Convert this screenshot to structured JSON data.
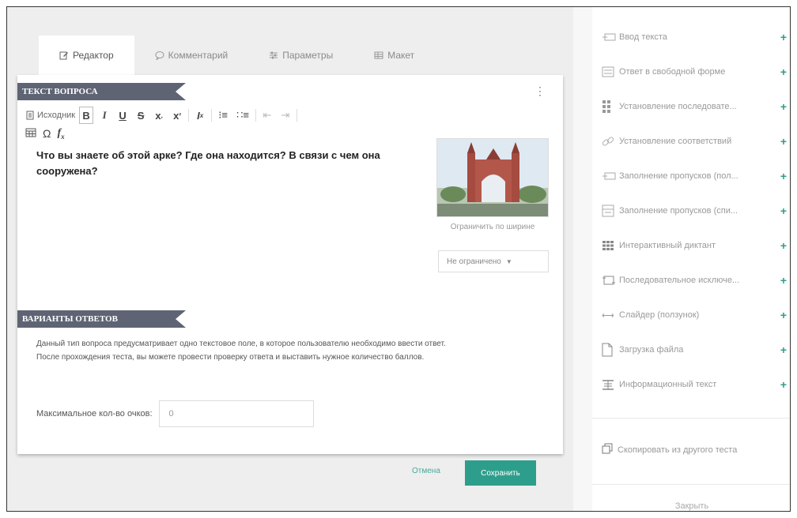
{
  "tabs": [
    {
      "label": "Редактор",
      "icon": "edit-icon"
    },
    {
      "label": "Комментарий",
      "icon": "comment-icon"
    },
    {
      "label": "Параметры",
      "icon": "sliders-icon"
    },
    {
      "label": "Макет",
      "icon": "layout-icon"
    }
  ],
  "question_section": {
    "title": "ТЕКСТ ВОПРОСА",
    "source_label": "Исходник",
    "question_text": "Что вы знаете об этой арке? Где она находится? В связи с чем она сооружена?",
    "image_limit_note": "Ограничить по ширине",
    "image_limit_value": "Не ограничено"
  },
  "answers_section": {
    "title": "ВАРИАНТЫ ОТВЕТОВ",
    "description_line1": "Данный тип вопроса предусматривает одно текстовое поле, в которое пользователю необходимо ввести ответ.",
    "description_line2": "После прохождения теста, вы можете провести проверку ответа и выставить нужное количество баллов.",
    "max_points_label": "Максимальное кол-во очков:",
    "max_points_value": "0"
  },
  "actions": {
    "cancel": "Отмена",
    "save": "Сохранить"
  },
  "sidebar": {
    "items": [
      {
        "label": "Ввод текста",
        "icon": "text-input-icon"
      },
      {
        "label": "Ответ в свободной форме",
        "icon": "free-form-icon"
      },
      {
        "label": "Установление последовате...",
        "icon": "sequence-icon"
      },
      {
        "label": "Установление соответствий",
        "icon": "link-icon"
      },
      {
        "label": "Заполнение пропусков (пол...",
        "icon": "gap-fill-icon"
      },
      {
        "label": "Заполнение пропусков (спи...",
        "icon": "gap-list-icon"
      },
      {
        "label": "Интерактивный диктант",
        "icon": "grid-icon"
      },
      {
        "label": "Последовательное исключе...",
        "icon": "exclusion-icon"
      },
      {
        "label": "Слайдер (ползунок)",
        "icon": "slider-icon"
      },
      {
        "label": "Загрузка файла",
        "icon": "file-icon"
      },
      {
        "label": "Информационный текст",
        "icon": "info-text-icon"
      }
    ],
    "copy_label": "Скопировать из другого теста",
    "close_label": "Закрыть"
  },
  "colors": {
    "accent": "#2e9e8c",
    "ribbon": "#5e6474"
  }
}
